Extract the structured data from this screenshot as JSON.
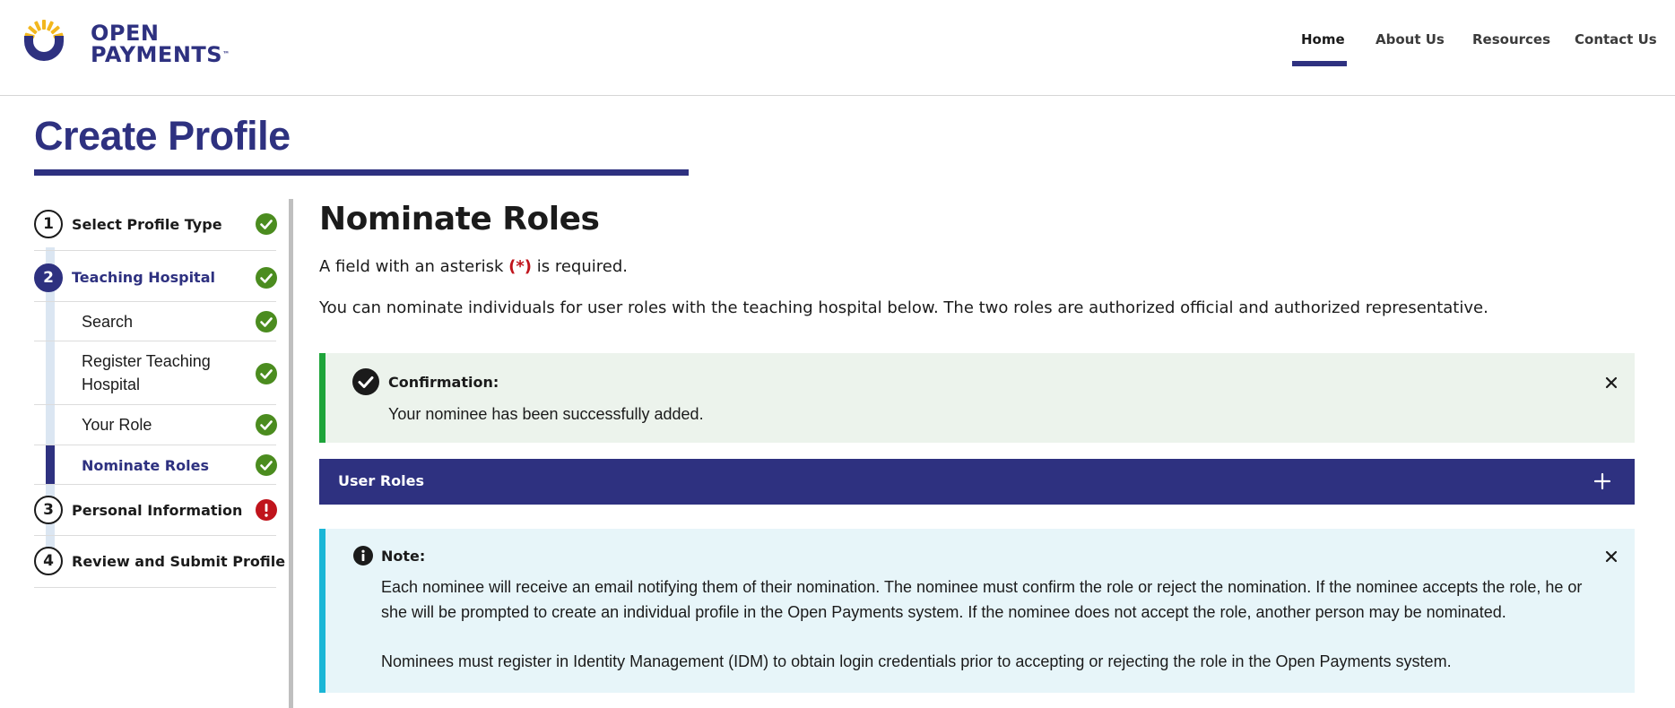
{
  "header": {
    "logo_line1": "OPEN",
    "logo_line2": "PAYMENTS",
    "logo_tm": "™",
    "nav": [
      {
        "label": "Home",
        "active": true
      },
      {
        "label": "About Us",
        "active": false
      },
      {
        "label": "Resources",
        "active": false
      },
      {
        "label": "Contact Us",
        "active": false
      }
    ]
  },
  "page": {
    "title": "Create Profile"
  },
  "sidebar": {
    "steps": [
      {
        "number": "1",
        "label": "Select Profile Type",
        "status": "complete"
      },
      {
        "number": "2",
        "label": "Teaching Hospital",
        "status": "complete",
        "active": true
      },
      {
        "number": "3",
        "label": "Personal Information",
        "status": "error"
      },
      {
        "number": "4",
        "label": "Review and Submit Profile",
        "status": "none"
      }
    ],
    "substeps": [
      {
        "label": "Search",
        "status": "complete"
      },
      {
        "label": "Register Teaching Hospital",
        "status": "complete"
      },
      {
        "label": "Your Role",
        "status": "complete"
      },
      {
        "label": "Nominate Roles",
        "status": "complete",
        "active": true
      }
    ]
  },
  "main": {
    "title": "Nominate Roles",
    "required_prefix": "A field with an asterisk ",
    "required_asterisk": "(*)",
    "required_suffix": " is required.",
    "intro": "You can nominate individuals for user roles with the teaching hospital below. The two roles are authorized official and authorized representative.",
    "confirmation": {
      "heading": "Confirmation:",
      "body": "Your nominee has been successfully added."
    },
    "accordion": {
      "label": "User Roles"
    },
    "note": {
      "heading": "Note:",
      "paragraph1": "Each nominee will receive an email notifying them of their nomination. The nominee must confirm the role or reject the nomination. If the nominee accepts the role, he or she will be prompted to create an individual profile in the Open Payments system. If the nominee does not accept the role, another person may be nominated.",
      "paragraph2": "Nominees must register in Identity Management (IDM) to obtain login credentials prior to accepting or rejecting the role in the Open Payments system."
    }
  },
  "colors": {
    "brand_navy": "#2e3180",
    "success_green": "#4b8c1f",
    "error_red": "#c0141c",
    "success_border": "#1ea43a",
    "info_border": "#1bb6d6",
    "logo_gold": "#f2b71e"
  },
  "icons": {
    "logo": "open-payments-sun-logo",
    "step_complete": "check-circle-icon",
    "step_error": "exclamation-circle-icon",
    "confirmation": "check-circle-icon",
    "note": "info-circle-icon",
    "close": "close-icon",
    "expand": "plus-icon"
  }
}
